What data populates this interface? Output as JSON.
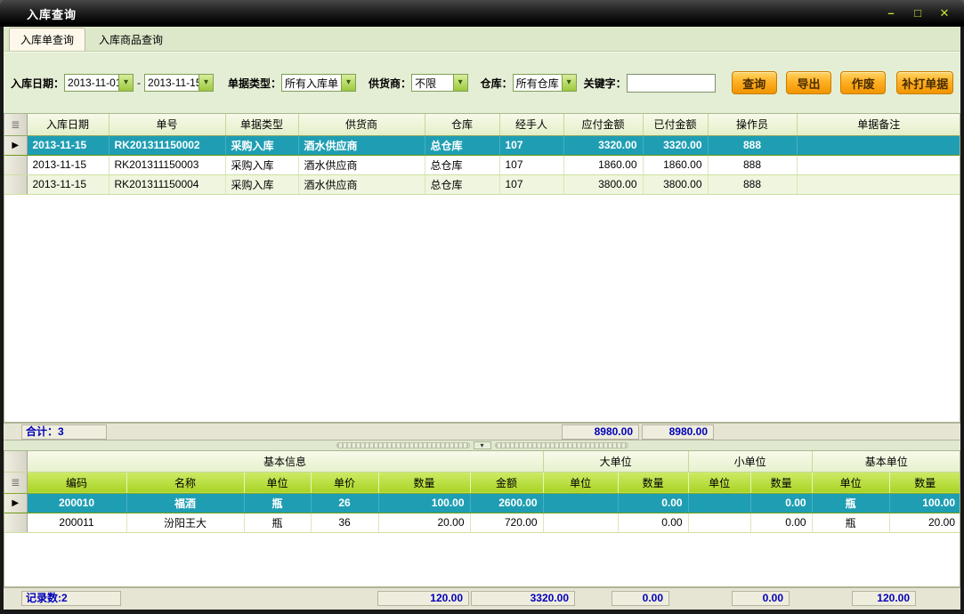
{
  "window": {
    "title": "入库查询"
  },
  "icons": {
    "minimize": "–",
    "maximize": "□",
    "close": "✕",
    "combo_arrow": "▾",
    "collapse_arrow": "▾",
    "row_marker": "≣",
    "selected_marker": "▶"
  },
  "tabs": [
    {
      "label": "入库单查询",
      "active": true
    },
    {
      "label": "入库商品查询",
      "active": false
    }
  ],
  "filters": {
    "date_label": "入库日期：",
    "date_from": "2013-11-01",
    "date_separator": "-",
    "date_to": "2013-11-15",
    "type_label": "单据类型：",
    "type_value": "所有入库单",
    "supplier_label": "供货商：",
    "supplier_value": "不限",
    "warehouse_label": "仓库：",
    "warehouse_value": "所有仓库",
    "keyword_label": "关键字：",
    "keyword_value": "",
    "buttons": [
      {
        "label": "查询"
      },
      {
        "label": "导出"
      },
      {
        "label": "作废"
      },
      {
        "label": "补打单据"
      }
    ]
  },
  "main_table": {
    "columns": [
      "入库日期",
      "单号",
      "单据类型",
      "供货商",
      "仓库",
      "经手人",
      "应付金额",
      "已付金额",
      "操作员",
      "单据备注"
    ],
    "rows": [
      [
        "2013-11-15",
        "RK201311150002",
        "采购入库",
        "酒水供应商",
        "总仓库",
        "107",
        "3320.00",
        "3320.00",
        "888",
        ""
      ],
      [
        "2013-11-15",
        "RK201311150003",
        "采购入库",
        "酒水供应商",
        "总仓库",
        "107",
        "1860.00",
        "1860.00",
        "888",
        ""
      ],
      [
        "2013-11-15",
        "RK201311150004",
        "采购入库",
        "酒水供应商",
        "总仓库",
        "107",
        "3800.00",
        "3800.00",
        "888",
        ""
      ]
    ],
    "selected_row": 0,
    "summary": {
      "label": "合计：3",
      "payable_total": "8980.00",
      "paid_total": "8980.00"
    }
  },
  "detail_table": {
    "groups": [
      {
        "label": "基本信息",
        "span": 6
      },
      {
        "label": "大单位",
        "span": 2
      },
      {
        "label": "小单位",
        "span": 2
      },
      {
        "label": "基本单位",
        "span": 2
      }
    ],
    "columns": [
      "编码",
      "名称",
      "单位",
      "单价",
      "数量",
      "金额",
      "单位",
      "数量",
      "单位",
      "数量",
      "单位",
      "数量"
    ],
    "rows": [
      [
        "200010",
        "福酒",
        "瓶",
        "26",
        "100.00",
        "2600.00",
        "",
        "0.00",
        "",
        "0.00",
        "瓶",
        "100.00"
      ],
      [
        "200011",
        "汾阳王大",
        "瓶",
        "36",
        "20.00",
        "720.00",
        "",
        "0.00",
        "",
        "0.00",
        "瓶",
        "20.00"
      ]
    ],
    "selected_row": 0,
    "summary": {
      "label": "记录数:2",
      "qty_total": "120.00",
      "amount_total": "3320.00",
      "big_qty_total": "0.00",
      "small_qty_total": "0.00",
      "base_qty_total": "120.00"
    }
  },
  "colors": {
    "accent_orange": "#f5a000",
    "selected_row": "#1f9eb3",
    "header_green": "#abd42a",
    "summary_text": "#0000bb",
    "title_glyphs": "#c6e132"
  }
}
